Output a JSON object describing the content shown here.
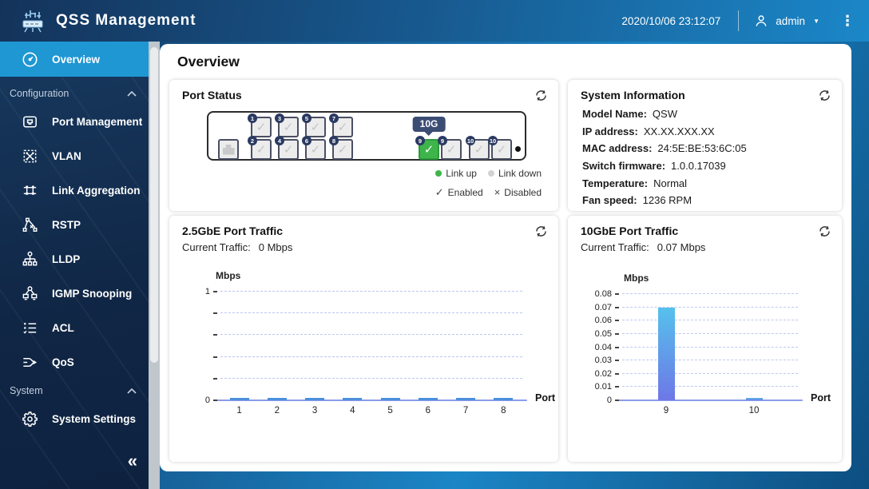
{
  "topbar": {
    "app_title": "QSS Management",
    "datetime": "2020/10/06 23:12:07",
    "user": "admin"
  },
  "icons": {
    "caret_down": "▼",
    "menu_dots": "⋮",
    "collapse": "«"
  },
  "sidebar": {
    "overview": "Overview",
    "configuration": "Configuration",
    "port_management": "Port Management",
    "vlan": "VLAN",
    "link_aggregation": "Link Aggregation",
    "rstp": "RSTP",
    "lldp": "LLDP",
    "igmp_snooping": "IGMP Snooping",
    "acl": "ACL",
    "qos": "QoS",
    "system": "System",
    "system_settings": "System Settings"
  },
  "main": {
    "page_title": "Overview",
    "port_status": {
      "title": "Port Status",
      "tooltip": "10G",
      "ports_top": [
        "1",
        "3",
        "5",
        "7"
      ],
      "ports_bottom": [
        "2",
        "4",
        "6",
        "8"
      ],
      "ports_right": [
        {
          "num": "9",
          "link": "up"
        },
        {
          "num": "9",
          "link": "down"
        },
        {
          "num": "10",
          "link": "down"
        },
        {
          "num": "10",
          "link": "down"
        }
      ],
      "legend": {
        "link_up": "Link up",
        "link_down": "Link down",
        "enabled_mark": "✓",
        "enabled": "Enabled",
        "disabled_mark": "×",
        "disabled": "Disabled"
      },
      "colors": {
        "link_up": "#3db54a",
        "link_down": "#d2d2d2"
      }
    },
    "system_info": {
      "title": "System Information",
      "rows": [
        {
          "label": "Model Name:",
          "value": "QSW"
        },
        {
          "label": "IP address:",
          "value": "XX.XX.XXX.XX"
        },
        {
          "label": "MAC address:",
          "value": "24:5E:BE:53:6C:05"
        },
        {
          "label": "Switch firmware:",
          "value": "1.0.0.17039"
        },
        {
          "label": "Temperature:",
          "value": "Normal"
        },
        {
          "label": "Fan speed:",
          "value": "1236 RPM"
        }
      ]
    }
  },
  "chart_data": [
    {
      "type": "bar",
      "title": "2.5GbE Port Traffic",
      "current_traffic_label": "Current Traffic:",
      "current_traffic_value": "0 Mbps",
      "ylabel": "Mbps",
      "xlabel": "Port",
      "categories": [
        "1",
        "2",
        "3",
        "4",
        "5",
        "6",
        "7",
        "8"
      ],
      "values": [
        0,
        0,
        0,
        0,
        0,
        0,
        0,
        0
      ],
      "ylim": [
        0,
        1
      ],
      "yticks": [
        {
          "v": 1,
          "label": "1"
        },
        {
          "v": 0.8,
          "label": ""
        },
        {
          "v": 0.6,
          "label": ""
        },
        {
          "v": 0.4,
          "label": ""
        },
        {
          "v": 0.2,
          "label": ""
        },
        {
          "v": 0,
          "label": "0"
        }
      ],
      "grid": "dashed",
      "bar_color_top": "#4a8fdd",
      "bar_color_bottom": "#4a8fdd"
    },
    {
      "type": "bar",
      "title": "10GbE Port Traffic",
      "current_traffic_label": "Current Traffic:",
      "current_traffic_value": "0.07 Mbps",
      "ylabel": "Mbps",
      "xlabel": "Port",
      "categories": [
        "9",
        "10"
      ],
      "values": [
        0.07,
        0.002
      ],
      "ylim": [
        0,
        0.08
      ],
      "yticks": [
        {
          "v": 0.08,
          "label": "0.08"
        },
        {
          "v": 0.07,
          "label": "0.07"
        },
        {
          "v": 0.06,
          "label": "0.06"
        },
        {
          "v": 0.05,
          "label": "0.05"
        },
        {
          "v": 0.04,
          "label": "0.04"
        },
        {
          "v": 0.03,
          "label": "0.03"
        },
        {
          "v": 0.02,
          "label": "0.02"
        },
        {
          "v": 0.01,
          "label": "0.01"
        },
        {
          "v": 0,
          "label": "0"
        }
      ],
      "grid": "dashed",
      "bar_color_top": "#55c1ec",
      "bar_color_bottom": "#6e77e7"
    }
  ]
}
